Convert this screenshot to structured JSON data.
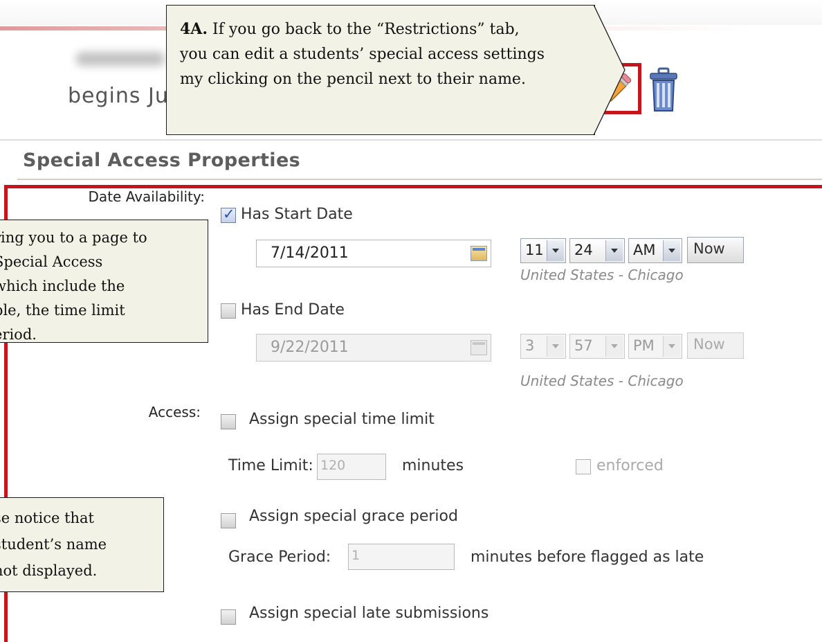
{
  "background_text": {
    "partial_begins": "begins Ju"
  },
  "callouts": {
    "top": {
      "bold": "4A.",
      "line1_rest": " If you go back to the “Restrictions” tab,",
      "line2": "you can edit a students’ special access settings",
      "line3": "my clicking on the pencil next to their name."
    },
    "left1": {
      "line1": "ring you to a page to",
      "line2": "Special Access",
      "line3": "which include the",
      "line4": "ble, the time limit",
      "line5": "eriod."
    },
    "left2": {
      "line1": "se notice that",
      "line2": "student’s name",
      "line3": "not displayed."
    }
  },
  "section": {
    "title": "Special Access Properties"
  },
  "date_availability": {
    "label": "Date Availability:",
    "start": {
      "checkbox_label": "Has Start Date",
      "checked": true,
      "date": "7/14/2011",
      "hour": "11",
      "minute": "24",
      "ampm": "AM",
      "now_label": "Now",
      "timezone": "United States - Chicago"
    },
    "end": {
      "checkbox_label": "Has End Date",
      "checked": false,
      "date": "9/22/2011",
      "hour": "3",
      "minute": "57",
      "ampm": "PM",
      "now_label": "Now",
      "timezone": "United States - Chicago"
    }
  },
  "access": {
    "label": "Access:",
    "time_limit": {
      "checkbox_label": "Assign special time limit",
      "field_label": "Time Limit:",
      "value": "120",
      "unit": "minutes",
      "enforced_label": "enforced"
    },
    "grace_period": {
      "checkbox_label": "Assign special grace period",
      "field_label": "Grace Period:",
      "value": "1",
      "unit": "minutes before flagged as late"
    },
    "late_submissions": {
      "checkbox_label": "Assign special late submissions"
    }
  },
  "icons": [
    "pencil-icon",
    "trash-icon",
    "calendar-icon",
    "chevron-down-icon",
    "checkmark-icon"
  ],
  "colors": {
    "highlight_red": "#c5161d",
    "callout_bg": "#f2f2e6"
  }
}
